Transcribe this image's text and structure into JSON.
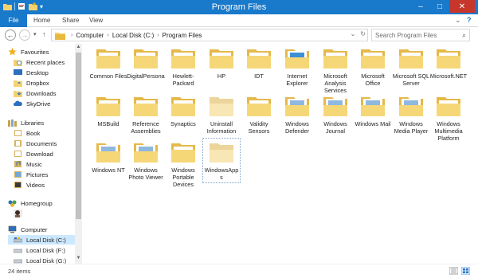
{
  "window": {
    "title": "Program Files",
    "controls": {
      "minimize": "–",
      "maximize": "□",
      "close": "✕"
    },
    "accent": "#1979ca"
  },
  "ribbon": {
    "tabs": [
      "File",
      "Home",
      "Share",
      "View"
    ],
    "expand": "⌄",
    "help": "?"
  },
  "nav_buttons": {
    "back": "←",
    "forward": "→",
    "recent": "▾",
    "up": "↑"
  },
  "address": {
    "crumbs": [
      "Computer",
      "Local Disk (C:)",
      "Program Files"
    ],
    "sep": "›",
    "dropdown": "⌄",
    "refresh": "↻"
  },
  "search": {
    "placeholder": "Search Program Files",
    "icon": "⌕"
  },
  "nav_pane": {
    "items": [
      {
        "label": "Favourites",
        "icon": "star-icon"
      },
      {
        "label": "Recent places",
        "icon": "recent-places-icon"
      },
      {
        "label": "Desktop",
        "icon": "desktop-icon"
      },
      {
        "label": "Dropbox",
        "icon": "dropbox-icon"
      },
      {
        "label": "Downloads",
        "icon": "downloads-icon"
      },
      {
        "label": "SkyDrive",
        "icon": "skydrive-icon"
      },
      {
        "label": "Libraries",
        "icon": "libraries-icon"
      },
      {
        "label": "Book",
        "icon": "library-icon"
      },
      {
        "label": "Documents",
        "icon": "documents-icon"
      },
      {
        "label": "Download",
        "icon": "library-icon"
      },
      {
        "label": "Music",
        "icon": "music-icon"
      },
      {
        "label": "Pictures",
        "icon": "pictures-icon"
      },
      {
        "label": "Videos",
        "icon": "videos-icon"
      },
      {
        "label": "Homegroup",
        "icon": "homegroup-icon"
      },
      {
        "label": "",
        "icon": "user-avatar-icon"
      },
      {
        "label": "Computer",
        "icon": "computer-icon"
      },
      {
        "label": "Local Disk (C:)",
        "icon": "drive-icon"
      },
      {
        "label": "Local Disk (F:)",
        "icon": "drive-icon"
      },
      {
        "label": "Local Disk (G:)",
        "icon": "drive-icon"
      }
    ],
    "scroll_up": "▲",
    "scroll_down": "▼"
  },
  "folders": [
    {
      "label": "Common Files",
      "variant": "plain"
    },
    {
      "label": "DigitalPersona",
      "variant": "plain"
    },
    {
      "label": "Hewlett-Packard",
      "variant": "plain"
    },
    {
      "label": "HP",
      "variant": "plain"
    },
    {
      "label": "IDT",
      "variant": "plain"
    },
    {
      "label": "Internet Explorer",
      "variant": "app"
    },
    {
      "label": "Microsoft Analysis Services",
      "variant": "plain"
    },
    {
      "label": "Microsoft Office",
      "variant": "plain"
    },
    {
      "label": "Microsoft SQL Server",
      "variant": "plain"
    },
    {
      "label": "Microsoft.NET",
      "variant": "plain"
    },
    {
      "label": "MSBuild",
      "variant": "plain"
    },
    {
      "label": "Reference Assemblies",
      "variant": "plain"
    },
    {
      "label": "Synaptics",
      "variant": "plain"
    },
    {
      "label": "Uninstall Information",
      "variant": "empty"
    },
    {
      "label": "Validity Sensors",
      "variant": "plain"
    },
    {
      "label": "Windows Defender",
      "variant": "app"
    },
    {
      "label": "Windows Journal",
      "variant": "app"
    },
    {
      "label": "Windows Mail",
      "variant": "app"
    },
    {
      "label": "Windows Media Player",
      "variant": "app"
    },
    {
      "label": "Windows Multimedia Platform",
      "variant": "plain"
    },
    {
      "label": "Windows NT",
      "variant": "app"
    },
    {
      "label": "Windows Photo Viewer",
      "variant": "app"
    },
    {
      "label": "Windows Portable Devices",
      "variant": "plain"
    },
    {
      "label": "WindowsApps",
      "variant": "empty"
    }
  ],
  "status": {
    "count": "24 items",
    "view_details": "details-view-icon",
    "view_icons": "large-icons-view-icon"
  }
}
